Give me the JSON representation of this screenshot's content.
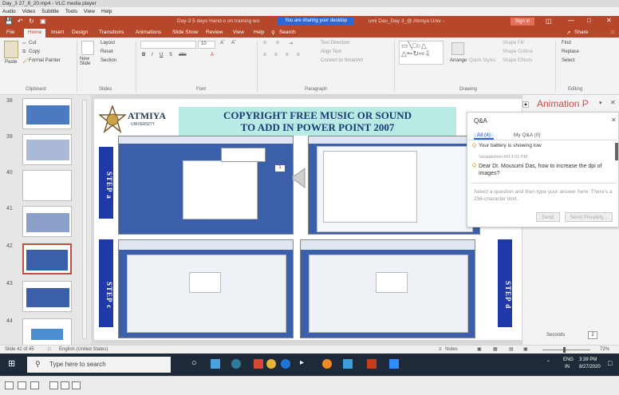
{
  "vlc": {
    "title": "Day_3 27_8_20.mp4 - VLC media player",
    "menu": [
      "Audio",
      "Video",
      "Subtitle",
      "Tools",
      "View",
      "Help"
    ]
  },
  "ppt": {
    "title": "Day-3 5 days Hand-s on training wo",
    "title_tail": "umi Das_Day 3_@ Atmiya Univ -",
    "share_banner": "You are sharing your desktop",
    "signin": "Sign in",
    "tabs": [
      "File",
      "Home",
      "Insert",
      "Design",
      "Transitions",
      "Animations",
      "Slide Show",
      "Review",
      "View",
      "Help"
    ],
    "search_tab": "Search",
    "share": "Share"
  },
  "ribbon": {
    "clipboard": {
      "paste": "Paste",
      "cut": "Cut",
      "copy": "Copy",
      "format_painter": "Format Painter",
      "label": "Clipboard"
    },
    "slides": {
      "new_slide": "New Slide",
      "layout": "Layout",
      "reset": "Reset",
      "section": "Section",
      "label": "Slides"
    },
    "font": {
      "size": "10",
      "label": "Font"
    },
    "paragraph": {
      "text_direction": "Text Direction",
      "align_text": "Align Text",
      "convert": "Convert to SmartArt",
      "label": "Paragraph"
    },
    "drawing": {
      "arrange": "Arrange",
      "quick_styles": "Quick Styles",
      "shape_fill": "Shape Fill",
      "shape_outline": "Shape Outline",
      "shape_effects": "Shape Effects",
      "label": "Drawing"
    },
    "editing": {
      "find": "Find",
      "replace": "Replace",
      "select": "Select",
      "label": "Editing"
    }
  },
  "thumbs": [
    "38",
    "39",
    "40",
    "41",
    "42",
    "43",
    "44"
  ],
  "slide": {
    "logo_name": "ATMIYA",
    "logo_sub": "UNIVERSITY",
    "title_line1": "COPYRIGHT FREE MUSIC OR SOUND",
    "title_line2": "TO ADD IN POWER POINT   2007",
    "step_a": "STEP a",
    "step_c": "STEP c",
    "step_d": "STEP d",
    "page_box": "1"
  },
  "qa": {
    "title": "Q&A",
    "tab_all": "All (4)",
    "tab_my": "My Q&A (0)",
    "battery": "Your battery is showing low",
    "asker": "Varalakshmi KN  3:01 PM",
    "question": "Dear Dr. Mousumi Das, how to increase the dpi of images?",
    "placeholder": "Select a question and then type your answer here. There's a 256-character limit.",
    "send": "Send",
    "send_privately": "Send Privately..."
  },
  "anim": {
    "title": "Animation P",
    "seconds": "Seconds",
    "seconds_val": "2"
  },
  "status": {
    "slide_of": "Slide 42 of 45",
    "language": "English (United States)",
    "notes": "Notes",
    "zoom": "72%"
  },
  "taskbar": {
    "search": "Type here to search",
    "lang1": "ENG",
    "lang2": "IN",
    "time": "3:39 PM",
    "date": "8/27/2020"
  }
}
